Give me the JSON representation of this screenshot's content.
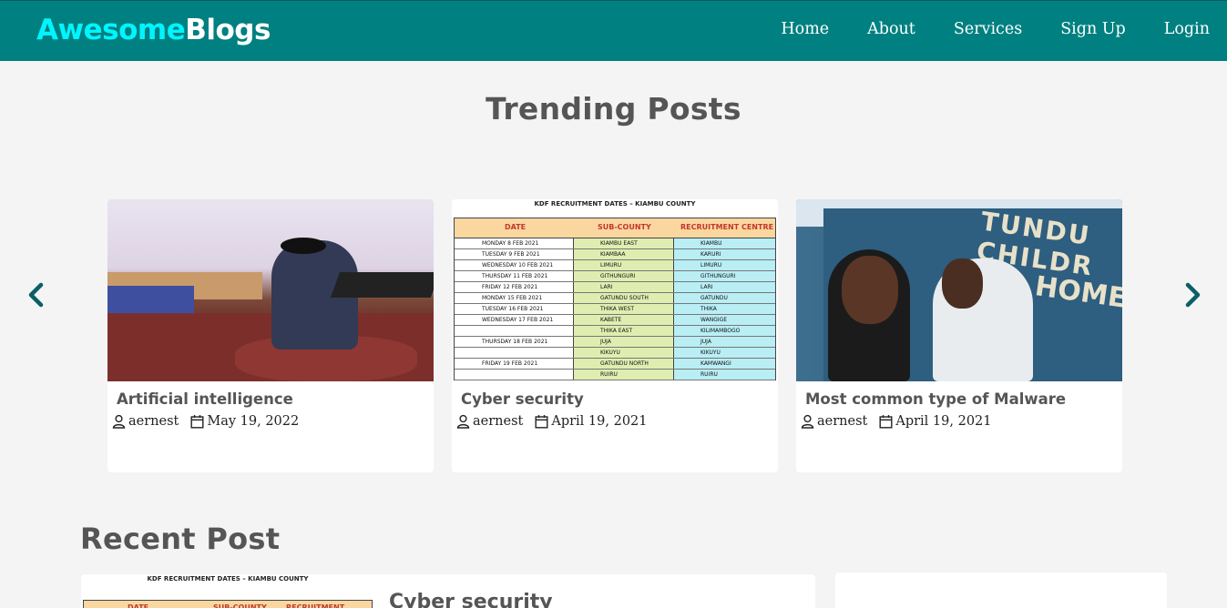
{
  "brand": {
    "part1": "Awesome",
    "part2": "Blogs"
  },
  "nav": {
    "items": [
      {
        "label": "Home"
      },
      {
        "label": "About"
      },
      {
        "label": "Services"
      },
      {
        "label": "Sign Up"
      },
      {
        "label": "Login"
      }
    ]
  },
  "trending": {
    "title": "Trending Posts",
    "posts": [
      {
        "title": "Artificial intelligence",
        "author": "aernest",
        "date": "May 19, 2022",
        "image": "person-with-laptop-photo"
      },
      {
        "title": "Cyber security",
        "author": "aernest",
        "date": "April 19, 2021",
        "image": "kdf-recruitment-table"
      },
      {
        "title": "Most common type of Malware",
        "author": "aernest",
        "date": "April 19, 2021",
        "image": "two-men-selfie-photo"
      }
    ]
  },
  "table_image": {
    "caption": "KDF RECRUITMENT DATES – KIAMBU COUNTY",
    "headers": [
      "DATE",
      "SUB-COUNTY",
      "RECRUITMENT CENTRE"
    ],
    "rows": [
      [
        "MONDAY 8 FEB 2021",
        "KIAMBU EAST",
        "KIAMBU"
      ],
      [
        "TUESDAY 9 FEB 2021",
        "KIAMBAA",
        "KARURI"
      ],
      [
        "WEDNESDAY 10 FEB 2021",
        "LIMURU",
        "LIMURU"
      ],
      [
        "THURSDAY 11 FEB 2021",
        "GITHUNGURI",
        "GITHUNGURI"
      ],
      [
        "FRIDAY 12 FEB 2021",
        "LARI",
        "LARI"
      ],
      [
        "MONDAY 15 FEB 2021",
        "GATUNDU SOUTH",
        "GATUNDU"
      ],
      [
        "TUESDAY 16 FEB 2021",
        "THIKA WEST",
        "THIKA"
      ],
      [
        "WEDNESDAY 17 FEB 2021",
        "KABETE",
        "WANGIGE"
      ],
      [
        "",
        "THIKA EAST",
        "KILIMAMBOGO"
      ],
      [
        "THURSDAY 18 FEB 2021",
        "JUJA",
        "JUJA"
      ],
      [
        "",
        "KIKUYU",
        "KIKUYU"
      ],
      [
        "FRIDAY 19 FEB 2021",
        "GATUNDU NORTH",
        "KAMWANGI"
      ],
      [
        "",
        "RUIRU",
        "RUIRU"
      ]
    ]
  },
  "malware_image": {
    "sign_line1": "TUNDU CHILDR",
    "sign_line2": "HOME"
  },
  "recent": {
    "title": "Recent Post",
    "post": {
      "title": "Cyber security"
    }
  },
  "colors": {
    "nav_bg": "#008080",
    "brand_accent": "#00f5ff",
    "page_bg": "#f4f4f4"
  },
  "icons": {
    "prev": "chevron-left-icon",
    "next": "chevron-right-icon",
    "author": "user-icon",
    "date": "calendar-icon"
  }
}
